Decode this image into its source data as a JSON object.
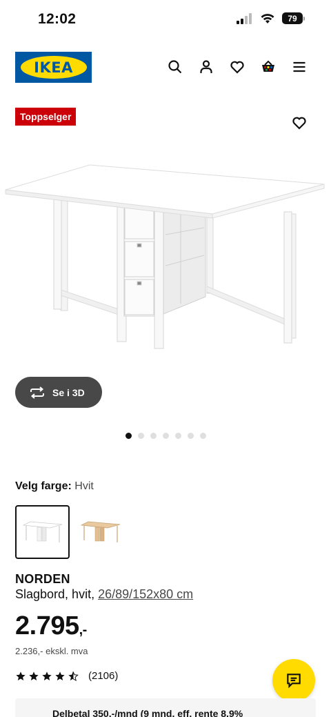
{
  "status": {
    "time": "12:02",
    "battery": "79"
  },
  "header": {
    "logo_text": "IKEA"
  },
  "badge": "Toppselger",
  "view3d": {
    "label": "Se i 3D"
  },
  "carousel": {
    "total": 7,
    "active": 0
  },
  "color": {
    "label": "Velg farge:",
    "value": "Hvit"
  },
  "product": {
    "name": "NORDEN",
    "desc": "Slagbord, hvit, ",
    "size": "26/89/152x80 cm",
    "price_main": "2.795",
    "price_suffix": ",-",
    "price_excl": "2.236,- ekskl. mva"
  },
  "rating": {
    "stars": 4.5,
    "count": "(2106)"
  },
  "finance": {
    "text": "Delbetal 350,-/mnd (9 mnd, eff. rente 8,9%"
  },
  "colors": {
    "ikea_blue": "#0058a3",
    "ikea_yellow": "#ffdb00",
    "badge_red": "#cc0008"
  },
  "icons": [
    "search-icon",
    "profile-icon",
    "heart-icon",
    "basket-icon",
    "menu-icon",
    "rotate-icon",
    "star-icon",
    "chat-icon"
  ]
}
